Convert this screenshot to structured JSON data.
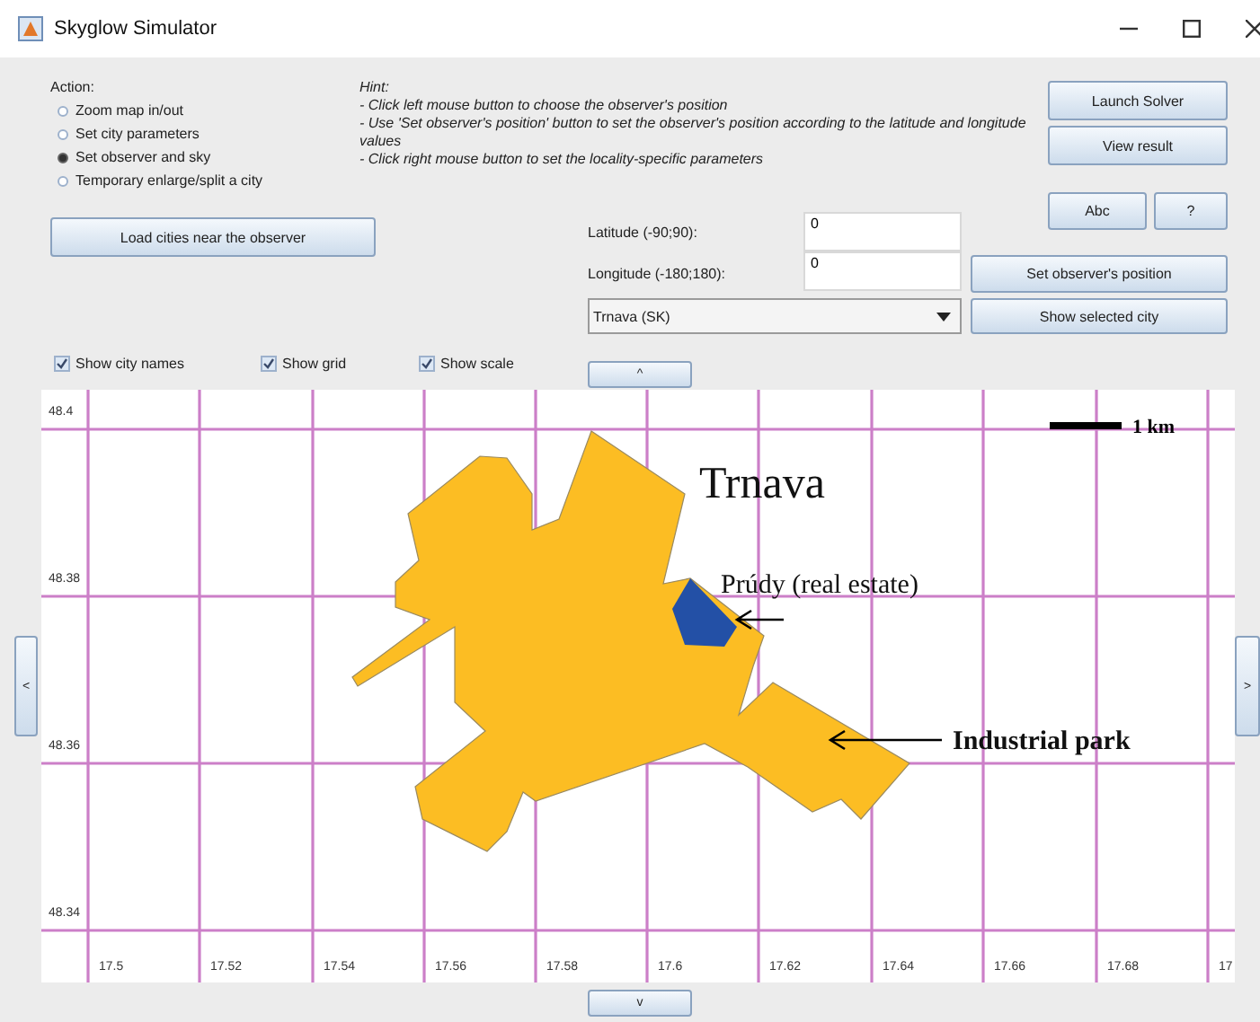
{
  "window": {
    "title": "Skyglow Simulator"
  },
  "action": {
    "label": "Action:",
    "options": [
      {
        "label": "Zoom map in/out",
        "selected": false
      },
      {
        "label": "Set city parameters",
        "selected": false
      },
      {
        "label": "Set observer and sky",
        "selected": true
      },
      {
        "label": "Temporary enlarge/split a city",
        "selected": false
      }
    ]
  },
  "load_button": "Load cities near the observer",
  "hint": {
    "title": "Hint:",
    "lines": [
      "- Click left mouse button to choose the observer's position",
      "- Use 'Set observer's position' button to set the observer's position according to the latitude and longitude values",
      "- Click right mouse button to set the locality-specific parameters"
    ]
  },
  "solver_buttons": [
    "Launch Solver",
    "View result"
  ],
  "small_buttons": [
    "Abc",
    "?"
  ],
  "latitude": {
    "label": "Latitude (-90;90):",
    "value": "0"
  },
  "longitude": {
    "label": "Longitude (-180;180):",
    "value": "0"
  },
  "set_position_button": "Set observer's position",
  "city_select": {
    "value": "Trnava (SK)"
  },
  "show_city_button": "Show selected city",
  "checkboxes": [
    {
      "label": "Show city names",
      "checked": true
    },
    {
      "label": "Show grid",
      "checked": true
    },
    {
      "label": "Show scale",
      "checked": true
    }
  ],
  "nav": {
    "up": "^",
    "down": "v",
    "left": "<",
    "right": ">"
  },
  "map": {
    "y_labels": [
      "48.4",
      "48.38",
      "48.36",
      "48.34"
    ],
    "x_labels": [
      "17.5",
      "17.52",
      "17.54",
      "17.56",
      "17.58",
      "17.6",
      "17.62",
      "17.64",
      "17.66",
      "17.68",
      "17"
    ],
    "scale_label": "1 km",
    "city_label": "Trnava",
    "annotations": [
      {
        "kind": "real_estate",
        "label": "Prúdy (real estate)"
      },
      {
        "kind": "industrial",
        "label": "Industrial park"
      }
    ]
  }
}
